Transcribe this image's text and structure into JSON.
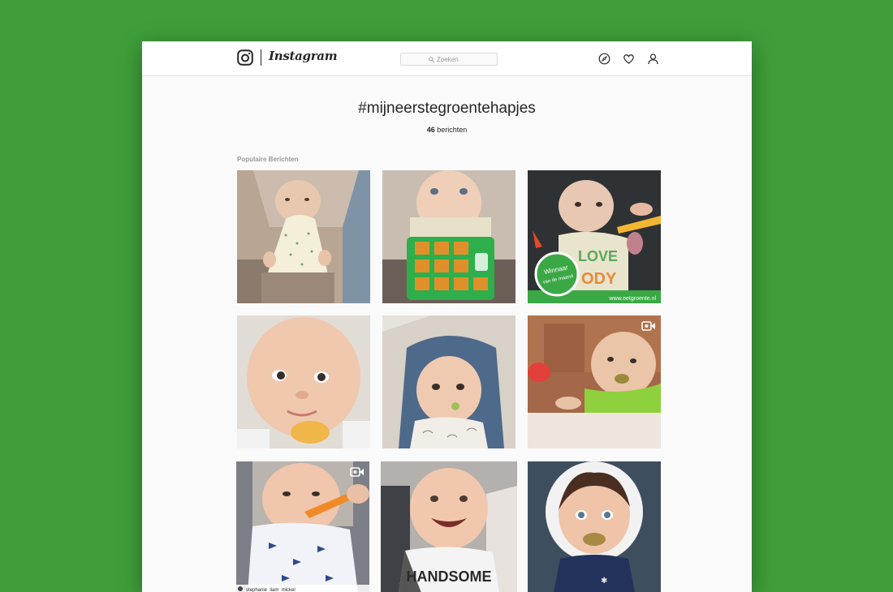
{
  "app": {
    "brand": "Instagram",
    "search_placeholder": "Zoeken"
  },
  "nav": {
    "icons": [
      "compass-icon",
      "heart-icon",
      "profile-icon"
    ]
  },
  "page": {
    "hashtag": "#mijneerstegroentehapjes",
    "post_count": "46",
    "post_count_label": "berichten",
    "section_label": "Populaire Berichten"
  },
  "posts": [
    {
      "row": 1,
      "col": 1,
      "type": "photo"
    },
    {
      "row": 1,
      "col": 2,
      "type": "photo"
    },
    {
      "row": 1,
      "col": 3,
      "type": "photo",
      "overlay_line1": "Winnaar",
      "overlay_line2": "van de maand",
      "url_text": "www.eetgroente.nl"
    },
    {
      "row": 2,
      "col": 1,
      "type": "photo"
    },
    {
      "row": 2,
      "col": 2,
      "type": "photo"
    },
    {
      "row": 2,
      "col": 3,
      "type": "video"
    },
    {
      "row": 3,
      "col": 1,
      "type": "video",
      "caption": "stephanie_liam_mickel"
    },
    {
      "row": 3,
      "col": 2,
      "type": "photo",
      "shirt_text": "HANDSOME"
    },
    {
      "row": 3,
      "col": 3,
      "type": "photo"
    }
  ],
  "colors": {
    "background": "#3f9e3a",
    "window": "#fafafa",
    "topbar": "#ffffff",
    "text": "#262626",
    "muted": "#999999"
  }
}
